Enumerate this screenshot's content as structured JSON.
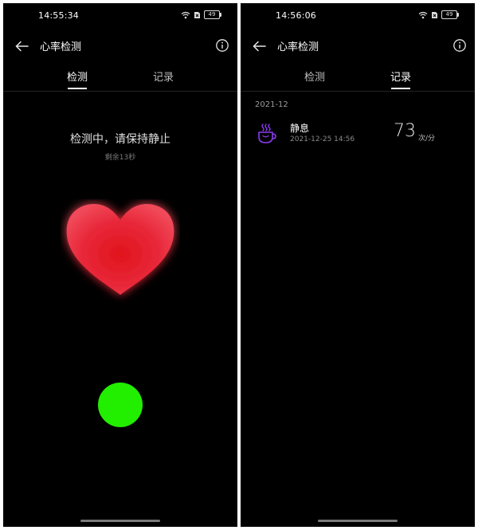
{
  "left": {
    "status": {
      "time": "14:55:34",
      "battery": "49"
    },
    "title": "心率检测",
    "tabs": [
      {
        "label": "检测",
        "active": true
      },
      {
        "label": "记录",
        "active": false
      }
    ],
    "message": "检测中，请保持静止",
    "remaining": "剩余13秒"
  },
  "right": {
    "status": {
      "time": "14:56:06",
      "battery": "49"
    },
    "title": "心率检测",
    "tabs": [
      {
        "label": "检测",
        "active": false
      },
      {
        "label": "记录",
        "active": true
      }
    ],
    "month": "2021-12",
    "record": {
      "title": "静息",
      "time": "2021-12-25 14:56",
      "value": "73",
      "unit": "次/分",
      "icon": "coffee-cup-icon"
    }
  },
  "colors": {
    "heart": "#e8202b",
    "dot": "#22ee00",
    "record_icon": "#8a3cf0"
  }
}
